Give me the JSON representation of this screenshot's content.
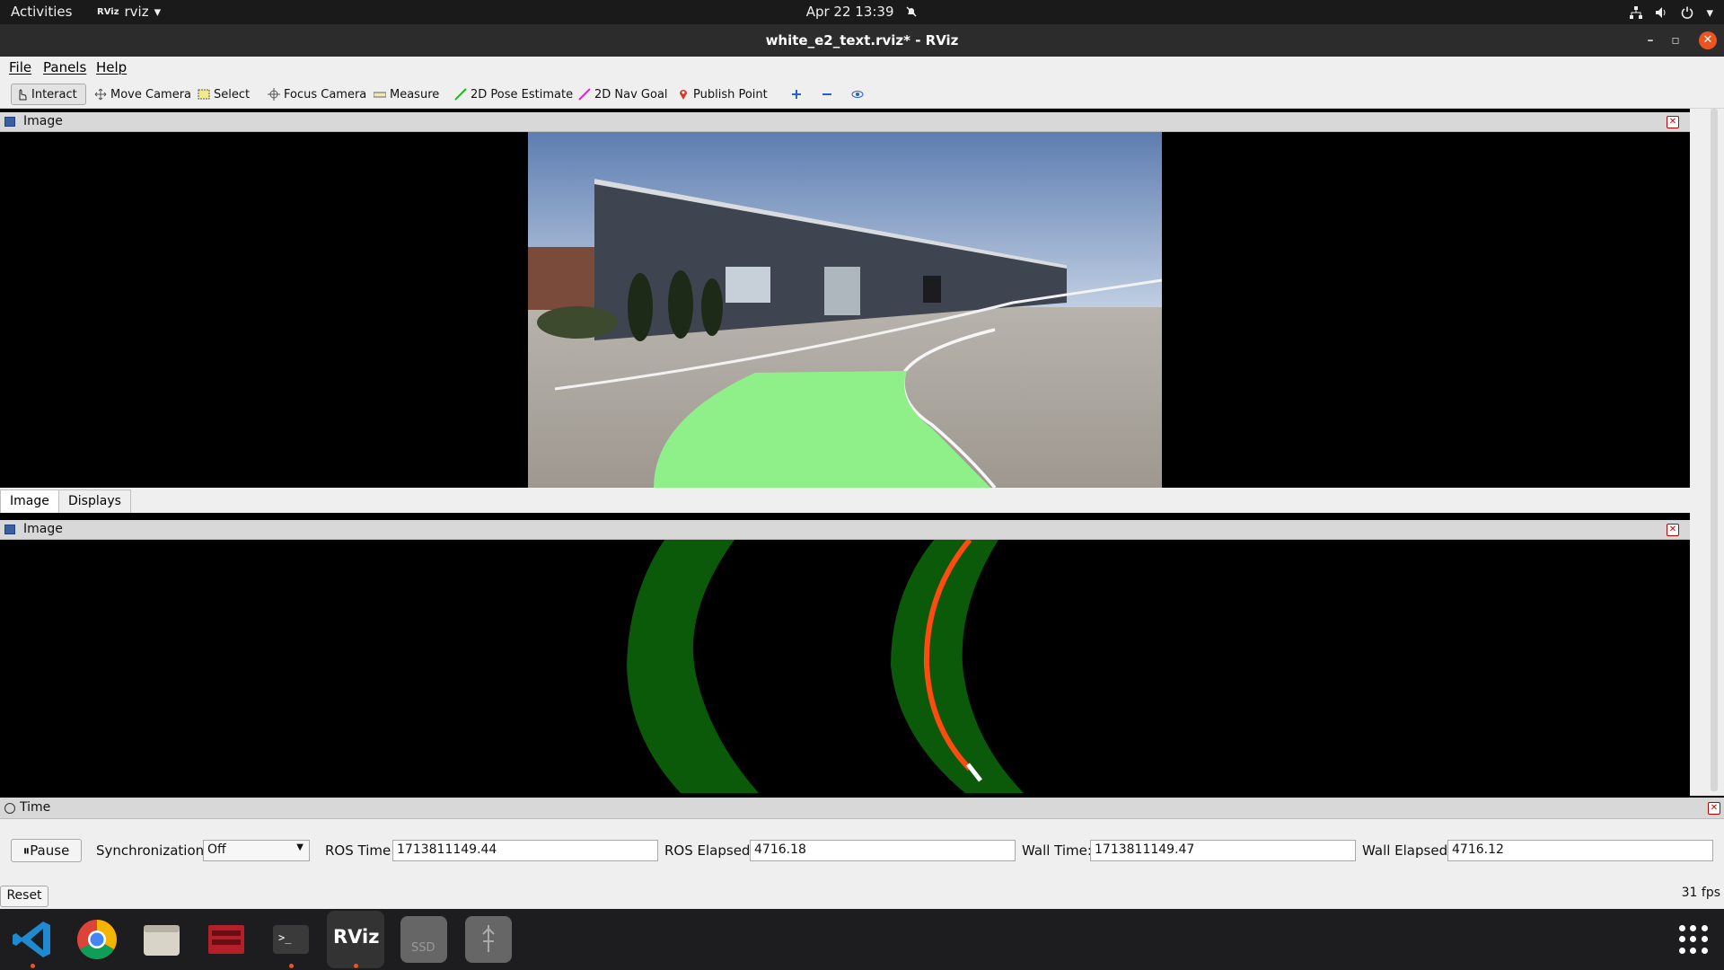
{
  "topbar": {
    "activities": "Activities",
    "app_name": "rviz",
    "app_logo": "RViz",
    "datetime": "Apr 22  13:39"
  },
  "window": {
    "title": "white_e2_text.rviz* - RViz"
  },
  "menu": [
    "File",
    "Panels",
    "Help"
  ],
  "toolbar": {
    "tools": [
      {
        "label": "Interact",
        "icon": "hand-pointer-icon"
      },
      {
        "label": "Move Camera",
        "icon": "move-arrows-icon"
      },
      {
        "label": "Select",
        "icon": "select-rectangle-icon"
      },
      {
        "label": "Focus Camera",
        "icon": "focus-crosshair-icon"
      },
      {
        "label": "Measure",
        "icon": "ruler-icon"
      },
      {
        "label": "2D Pose Estimate",
        "icon": "green-arrow-icon"
      },
      {
        "label": "2D Nav Goal",
        "icon": "pink-arrow-icon"
      },
      {
        "label": "Publish Point",
        "icon": "map-pin-icon"
      }
    ],
    "extra_icons": [
      "plus-icon",
      "minus-icon",
      "eye-icon"
    ]
  },
  "panels": {
    "image_top": {
      "title": "Image"
    },
    "image_bottom": {
      "title": "Image"
    }
  },
  "tabs": [
    "Image",
    "Displays"
  ],
  "time_panel": {
    "title": "Time",
    "pause_label": "Pause",
    "sync_label": "Synchronization:",
    "sync_value": "Off",
    "ros_time_label": "ROS Time:",
    "ros_time": "1713811149.44",
    "ros_elapsed_label": "ROS Elapsed:",
    "ros_elapsed": "4716.18",
    "wall_time_label": "Wall Time:",
    "wall_time": "1713811149.47",
    "wall_elapsed_label": "Wall Elapsed:",
    "wall_elapsed": "4716.12",
    "reset_label": "Reset",
    "fps": "31 fps"
  },
  "dock": {
    "apps": [
      "vscode-icon",
      "chrome-icon",
      "files-icon",
      "terminal-red-icon",
      "terminal-icon",
      "rviz-icon",
      "ssd-drive-icon",
      "usb-drive-icon"
    ],
    "rviz_label": "RViz",
    "ssd_label": "SSD"
  },
  "colors": {
    "lane_fill": "#8ff08a",
    "lane_mask": "#0a5a0a",
    "lane_line": "#ff4a10"
  }
}
